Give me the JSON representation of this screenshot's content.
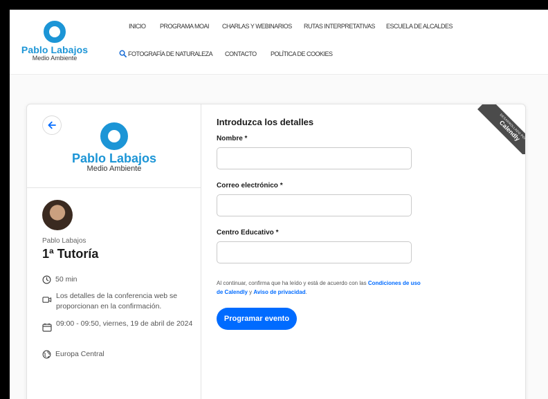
{
  "header": {
    "logo": {
      "name": "Pablo Labajos",
      "subtitle": "Medio Ambiente"
    },
    "nav": [
      {
        "label": "INICIO"
      },
      {
        "label": "PROGRAMA MOAI"
      },
      {
        "label": "CHARLAS Y WEBINARIOS"
      },
      {
        "label": "RUTAS INTERPRETATIVAS"
      },
      {
        "label": "ESCUELA DE ALCALDES"
      },
      {
        "label": "FOTOGRAFÍA DE NATURALEZA"
      },
      {
        "label": "CONTACTO"
      },
      {
        "label": "POLÍTICA DE COOKIES"
      }
    ]
  },
  "card": {
    "logo": {
      "name": "Pablo Labajos",
      "subtitle": "Medio Ambiente"
    },
    "host": "Pablo Labajos",
    "event_title": "1ª Tutoría",
    "details": {
      "duration": "50 min",
      "conference": "Los detalles de la conferencia web se proporcionan en la confirmación.",
      "datetime": "09:00 - 09:50, viernes, 19 de abril de 2024",
      "timezone": "Europa Central"
    },
    "ribbon": {
      "small": "desarrollado por",
      "big": "Calendly"
    }
  },
  "form": {
    "title": "Introduzca los detalles",
    "fields": [
      {
        "label": "Nombre *",
        "value": ""
      },
      {
        "label": "Correo electrónico *",
        "value": ""
      },
      {
        "label": "Centro Educativo *",
        "value": ""
      }
    ],
    "consent": {
      "text_before": "Al continuar, confirma que ha leído y está de acuerdo con las ",
      "terms_link": "Condiciones de uso de Calendly",
      "and": " y ",
      "privacy_link": "Aviso de privacidad",
      "end": "."
    },
    "submit_label": "Programar evento"
  },
  "colors": {
    "brand": "#1c95d6",
    "accent": "#006bff"
  }
}
